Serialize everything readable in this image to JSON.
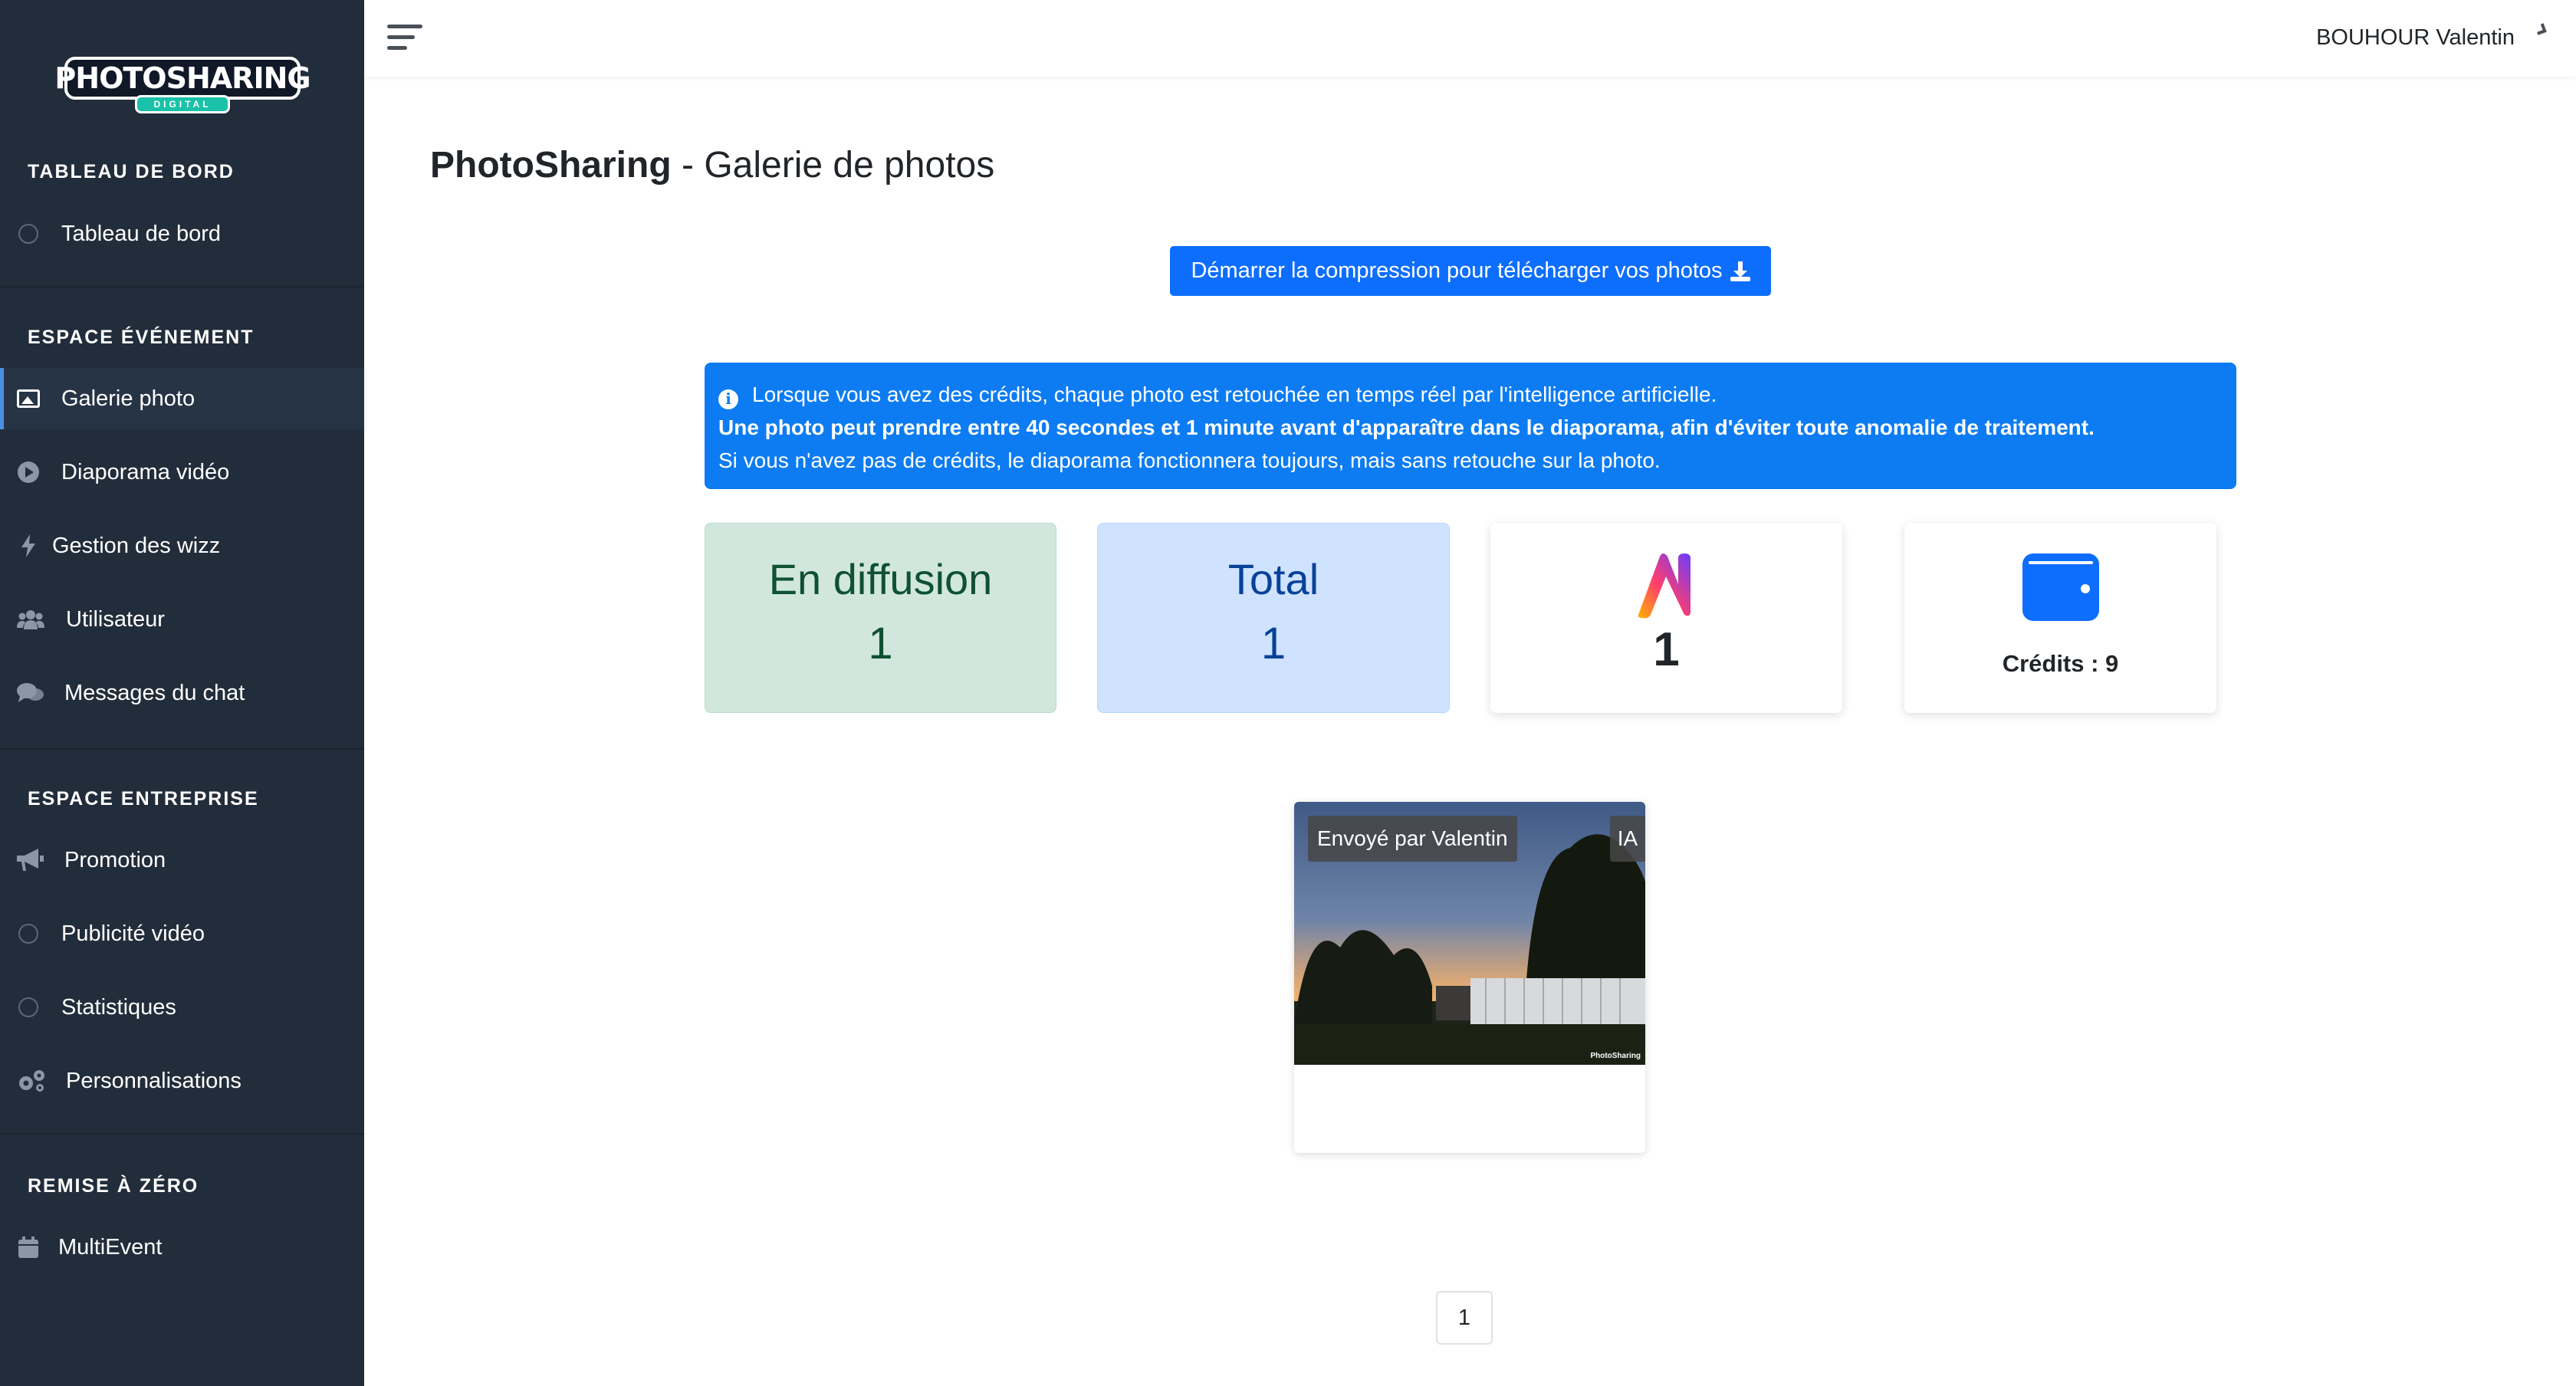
{
  "app": {
    "logo_text": "PHOTOSHARING",
    "logo_subtext": "DIGITAL"
  },
  "sidebar": {
    "sections": [
      {
        "heading": "TABLEAU DE BORD",
        "items": [
          {
            "label": "Tableau de bord",
            "icon": "circle-icon"
          }
        ]
      },
      {
        "heading": "ESPACE ÉVÉNEMENT",
        "items": [
          {
            "label": "Galerie photo",
            "icon": "image-icon",
            "active": true
          },
          {
            "label": "Diaporama vidéo",
            "icon": "play-circle-icon"
          },
          {
            "label": "Gestion des wizz",
            "icon": "bolt-icon"
          },
          {
            "label": "Utilisateur",
            "icon": "users-icon"
          },
          {
            "label": "Messages du chat",
            "icon": "comments-icon"
          }
        ]
      },
      {
        "heading": "ESPACE ENTREPRISE",
        "items": [
          {
            "label": "Promotion",
            "icon": "megaphone-icon"
          },
          {
            "label": "Publicité vidéo",
            "icon": "circle-icon"
          },
          {
            "label": "Statistiques",
            "icon": "circle-icon"
          },
          {
            "label": "Personnalisations",
            "icon": "cogs-icon"
          }
        ]
      },
      {
        "heading": "REMISE À ZÉRO",
        "items": [
          {
            "label": "MultiEvent",
            "icon": "calendar-icon"
          }
        ]
      }
    ]
  },
  "header": {
    "user_name": "BOUHOUR Valentin"
  },
  "main": {
    "title_brand": "PhotoSharing",
    "title_rest": " - Galerie de photos",
    "download_button": "Démarrer la compression pour télécharger vos photos",
    "alert": {
      "line1": "Lorsque vous avez des crédits, chaque photo est retouchée en temps réel par l'intelligence artificielle.",
      "line2": "Une photo peut prendre entre 40 secondes et 1 minute avant d'apparaître dans le diaporama, afin d'éviter toute anomalie de traitement.",
      "line3": "Si vous n'avez pas de crédits, le diaporama fonctionnera toujours, mais sans retouche sur la photo."
    },
    "stats": {
      "diffusion_label": "En diffusion",
      "diffusion_value": "1",
      "total_label": "Total",
      "total_value": "1",
      "ai_value": "1",
      "credits_text": "Crédits : 9"
    },
    "photos": [
      {
        "sender": "Envoyé par Valentin",
        "badge": "IA",
        "watermark": "PhotoSharing"
      }
    ],
    "pagination": [
      "1"
    ]
  },
  "colors": {
    "sidebar_bg": "#222d3b",
    "primary": "#0d6efd",
    "alert_bg": "#0d7cf2",
    "success_bg": "#d1e7dd",
    "success_text": "#0f5132",
    "info_bg": "#cfe2ff",
    "info_text": "#084298"
  }
}
